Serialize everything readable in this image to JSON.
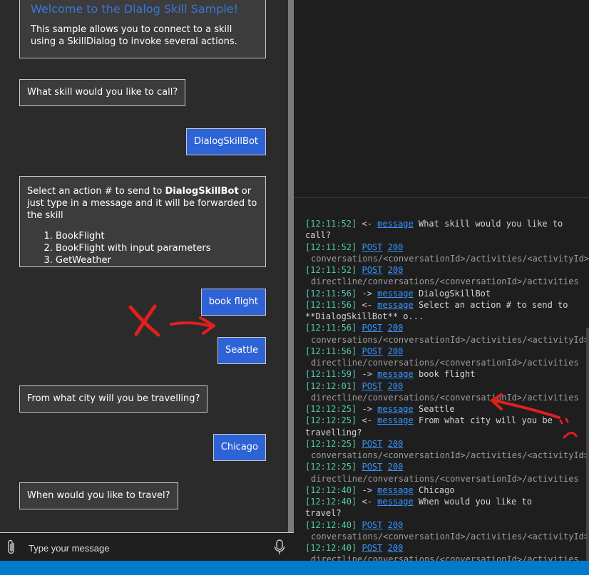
{
  "chat": {
    "welcome_title": "Welcome to the Dialog Skill Sample!",
    "welcome_text": "This sample allows you to connect to a skill using a SkillDialog to invoke several actions.",
    "q1": "What skill would you like to call?",
    "u1": "DialogSkillBot",
    "action_prefix": "Select an action # to send to ",
    "action_bold": "DialogSkillBot",
    "action_suffix": " or just type in a message and it will be forwarded to the skill",
    "actions": [
      "BookFlight",
      "BookFlight with input parameters",
      "GetWeather"
    ],
    "u2": "book flight",
    "u3": "Seattle",
    "q2": "From what city will you be travelling?",
    "u4": "Chicago",
    "q3": "When would you like to travel?",
    "input_placeholder": "Type your message"
  },
  "log": {
    "lines": [
      {
        "kind": "msg",
        "ts": "[12:11:52]",
        "dir": "<-",
        "link": "message",
        "text": "What skill would you like to"
      },
      {
        "kind": "cont",
        "text": "call?"
      },
      {
        "kind": "post",
        "ts": "[12:11:52]",
        "link": "POST",
        "code": "200"
      },
      {
        "kind": "path",
        "text": "conversations/<conversationId>/activities/<activityId>"
      },
      {
        "kind": "post",
        "ts": "[12:11:52]",
        "link": "POST",
        "code": "200"
      },
      {
        "kind": "path",
        "text": "directline/conversations/<conversationId>/activities"
      },
      {
        "kind": "msg",
        "ts": "[12:11:56]",
        "dir": "->",
        "link": "message",
        "text": "DialogSkillBot"
      },
      {
        "kind": "msg",
        "ts": "[12:11:56]",
        "dir": "<-",
        "link": "message",
        "text": "Select an action # to send to"
      },
      {
        "kind": "cont",
        "text": "**DialogSkillBot** o..."
      },
      {
        "kind": "post",
        "ts": "[12:11:56]",
        "link": "POST",
        "code": "200"
      },
      {
        "kind": "path",
        "text": "conversations/<conversationId>/activities/<activityId>"
      },
      {
        "kind": "post",
        "ts": "[12:11:56]",
        "link": "POST",
        "code": "200"
      },
      {
        "kind": "path",
        "text": "directline/conversations/<conversationId>/activities"
      },
      {
        "kind": "msg",
        "ts": "[12:11:59]",
        "dir": "->",
        "link": "message",
        "text": "book flight"
      },
      {
        "kind": "post",
        "ts": "[12:12:01]",
        "link": "POST",
        "code": "200"
      },
      {
        "kind": "path",
        "text": "directline/conversations/<conversationId>/activities"
      },
      {
        "kind": "msg",
        "ts": "[12:12:25]",
        "dir": "->",
        "link": "message",
        "text": "Seattle"
      },
      {
        "kind": "msg",
        "ts": "[12:12:25]",
        "dir": "<-",
        "link": "message",
        "text": "From what city will you be"
      },
      {
        "kind": "cont",
        "text": "travelling?"
      },
      {
        "kind": "post",
        "ts": "[12:12:25]",
        "link": "POST",
        "code": "200"
      },
      {
        "kind": "path",
        "text": "conversations/<conversationId>/activities/<activityId>"
      },
      {
        "kind": "post",
        "ts": "[12:12:25]",
        "link": "POST",
        "code": "200"
      },
      {
        "kind": "path",
        "text": "directline/conversations/<conversationId>/activities"
      },
      {
        "kind": "msg",
        "ts": "[12:12:40]",
        "dir": "->",
        "link": "message",
        "text": "Chicago"
      },
      {
        "kind": "msg",
        "ts": "[12:12:40]",
        "dir": "<-",
        "link": "message",
        "text": "When would you like to"
      },
      {
        "kind": "cont",
        "text": "travel?"
      },
      {
        "kind": "post",
        "ts": "[12:12:40]",
        "link": "POST",
        "code": "200"
      },
      {
        "kind": "path",
        "text": "conversations/<conversationId>/activities/<activityId>"
      },
      {
        "kind": "post",
        "ts": "[12:12:40]",
        "link": "POST",
        "code": "200"
      },
      {
        "kind": "path",
        "text": "directline/conversations/<conversationId>/activities"
      }
    ]
  },
  "colors": {
    "accent": "#2e63d6",
    "timestamp": "#4ec9b0",
    "link": "#3794ff",
    "annotation": "#e0201c",
    "statusbar": "#007acc"
  }
}
